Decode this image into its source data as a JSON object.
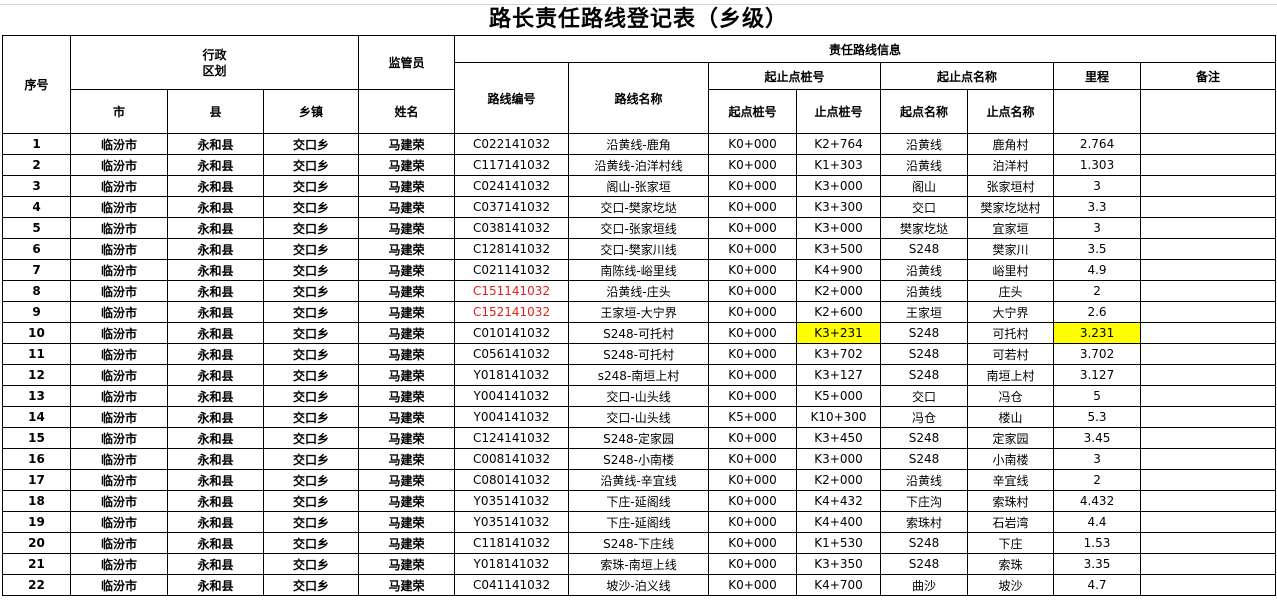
{
  "title": "路长责任路线登记表（乡级）",
  "headers": {
    "seq": "序号",
    "admin_region": "行政\n区划",
    "supervisor": "监管员",
    "route_info": "责任路线信息",
    "route_code": "路线编号",
    "route_name": "路线名称",
    "stake_range": "起止点桩号",
    "place_range": "起止点名称",
    "mileage": "里程",
    "remark": "备注",
    "city": "市",
    "county": "县",
    "township": "乡镇",
    "name": "姓名",
    "start_stake": "起点桩号",
    "end_stake": "止点桩号",
    "start_name": "起点名称",
    "end_name": "止点名称"
  },
  "rows": [
    {
      "seq": "1",
      "city": "临汾市",
      "county": "永和县",
      "township": "交口乡",
      "name": "马建荣",
      "code": "C022141032",
      "route": "沿黄线-鹿角",
      "start": "K0+000",
      "end": "K2+764",
      "from": "沿黄线",
      "to": "鹿角村",
      "km": "2.764"
    },
    {
      "seq": "2",
      "city": "临汾市",
      "county": "永和县",
      "township": "交口乡",
      "name": "马建荣",
      "code": "C117141032",
      "route": "沿黄线-泊洋村线",
      "start": "K0+000",
      "end": "K1+303",
      "from": "沿黄线",
      "to": "泊洋村",
      "km": "1.303"
    },
    {
      "seq": "3",
      "city": "临汾市",
      "county": "永和县",
      "township": "交口乡",
      "name": "马建荣",
      "code": "C024141032",
      "route": "阁山-张家垣",
      "start": "K0+000",
      "end": "K3+000",
      "from": "阁山",
      "to": "张家垣村",
      "km": "3"
    },
    {
      "seq": "4",
      "city": "临汾市",
      "county": "永和县",
      "township": "交口乡",
      "name": "马建荣",
      "code": "C037141032",
      "route": "交口-樊家圪垯",
      "start": "K0+000",
      "end": "K3+300",
      "from": "交口",
      "to": "樊家圪垯村",
      "km": "3.3"
    },
    {
      "seq": "5",
      "city": "临汾市",
      "county": "永和县",
      "township": "交口乡",
      "name": "马建荣",
      "code": "C038141032",
      "route": "交口-张家垣线",
      "start": "K0+000",
      "end": "K3+000",
      "from": "樊家圪垯",
      "to": "宜家垣",
      "km": "3"
    },
    {
      "seq": "6",
      "city": "临汾市",
      "county": "永和县",
      "township": "交口乡",
      "name": "马建荣",
      "code": "C128141032",
      "route": "交口-樊家川线",
      "start": "K0+000",
      "end": "K3+500",
      "from": "S248",
      "to": "樊家川",
      "km": "3.5"
    },
    {
      "seq": "7",
      "city": "临汾市",
      "county": "永和县",
      "township": "交口乡",
      "name": "马建荣",
      "code": "C021141032",
      "route": "南陈线-峪里线",
      "start": "K0+000",
      "end": "K4+900",
      "from": "沿黄线",
      "to": "峪里村",
      "km": "4.9"
    },
    {
      "seq": "8",
      "city": "临汾市",
      "county": "永和县",
      "township": "交口乡",
      "name": "马建荣",
      "code": "C151141032",
      "route": "沿黄线-庄头",
      "start": "K0+000",
      "end": "K2+000",
      "from": "沿黄线",
      "to": "庄头",
      "km": "2"
    },
    {
      "seq": "9",
      "city": "临汾市",
      "county": "永和县",
      "township": "交口乡",
      "name": "马建荣",
      "code": "C152141032",
      "route": "王家垣-大宁界",
      "start": "K0+000",
      "end": "K2+600",
      "from": "王家垣",
      "to": "大宁界",
      "km": "2.6"
    },
    {
      "seq": "10",
      "city": "临汾市",
      "county": "永和县",
      "township": "交口乡",
      "name": "马建荣",
      "code": "C010141032",
      "route": "S248-可托村",
      "start": "K0+000",
      "end": "K3+231",
      "from": "S248",
      "to": "可托村",
      "km": "3.231"
    },
    {
      "seq": "11",
      "city": "临汾市",
      "county": "永和县",
      "township": "交口乡",
      "name": "马建荣",
      "code": "C056141032",
      "route": "S248-可托村",
      "start": "K0+000",
      "end": "K3+702",
      "from": "S248",
      "to": "可若村",
      "km": "3.702"
    },
    {
      "seq": "12",
      "city": "临汾市",
      "county": "永和县",
      "township": "交口乡",
      "name": "马建荣",
      "code": "Y018141032",
      "route": "s248-南垣上村",
      "start": "K0+000",
      "end": "K3+127",
      "from": "S248",
      "to": "南垣上村",
      "km": "3.127"
    },
    {
      "seq": "13",
      "city": "临汾市",
      "county": "永和县",
      "township": "交口乡",
      "name": "马建荣",
      "code": "Y004141032",
      "route": "交口-山头线",
      "start": "K0+000",
      "end": "K5+000",
      "from": "交口",
      "to": "冯仓",
      "km": "5"
    },
    {
      "seq": "14",
      "city": "临汾市",
      "county": "永和县",
      "township": "交口乡",
      "name": "马建荣",
      "code": "Y004141032",
      "route": "交口-山头线",
      "start": "K5+000",
      "end": "K10+300",
      "from": "冯仓",
      "to": "楼山",
      "km": "5.3"
    },
    {
      "seq": "15",
      "city": "临汾市",
      "county": "永和县",
      "township": "交口乡",
      "name": "马建荣",
      "code": "C124141032",
      "route": "S248-定家园",
      "start": "K0+000",
      "end": "K3+450",
      "from": "S248",
      "to": "定家园",
      "km": "3.45"
    },
    {
      "seq": "16",
      "city": "临汾市",
      "county": "永和县",
      "township": "交口乡",
      "name": "马建荣",
      "code": "C008141032",
      "route": "S248-小南楼",
      "start": "K0+000",
      "end": "K3+000",
      "from": "S248",
      "to": "小南楼",
      "km": "3"
    },
    {
      "seq": "17",
      "city": "临汾市",
      "county": "永和县",
      "township": "交口乡",
      "name": "马建荣",
      "code": "C080141032",
      "route": "沿黄线-辛宜线",
      "start": "K0+000",
      "end": "K2+000",
      "from": "沿黄线",
      "to": "辛宜线",
      "km": "2"
    },
    {
      "seq": "18",
      "city": "临汾市",
      "county": "永和县",
      "township": "交口乡",
      "name": "马建荣",
      "code": "Y035141032",
      "route": "下庄-延阁线",
      "start": "K0+000",
      "end": "K4+432",
      "from": "下庄沟",
      "to": "索珠村",
      "km": "4.432"
    },
    {
      "seq": "19",
      "city": "临汾市",
      "county": "永和县",
      "township": "交口乡",
      "name": "马建荣",
      "code": "Y035141032",
      "route": "下庄-延阁线",
      "start": "K0+000",
      "end": "K4+400",
      "from": "索珠村",
      "to": "石岩湾",
      "km": "4.4"
    },
    {
      "seq": "20",
      "city": "临汾市",
      "county": "永和县",
      "township": "交口乡",
      "name": "马建荣",
      "code": "C118141032",
      "route": "S248-下庄线",
      "start": "K0+000",
      "end": "K1+530",
      "from": "S248",
      "to": "下庄",
      "km": "1.53"
    },
    {
      "seq": "21",
      "city": "临汾市",
      "county": "永和县",
      "township": "交口乡",
      "name": "马建荣",
      "code": "Y018141032",
      "route": "索珠-南垣上线",
      "start": "K0+000",
      "end": "K3+350",
      "from": "S248",
      "to": "索珠",
      "km": "3.35"
    },
    {
      "seq": "22",
      "city": "临汾市",
      "county": "永和县",
      "township": "交口乡",
      "name": "马建荣",
      "code": "C041141032",
      "route": "坡沙-泊义线",
      "start": "K0+000",
      "end": "K4+700",
      "from": "曲沙",
      "to": "坡沙",
      "km": "4.7"
    }
  ],
  "styles": {
    "highlight_color": "#ffff00",
    "red_text_color": "#e0211c",
    "red_code_rows": [
      "8",
      "9"
    ],
    "highlighted_cells": [
      {
        "seq": "10",
        "field": "end"
      },
      {
        "seq": "10",
        "field": "km"
      }
    ]
  }
}
